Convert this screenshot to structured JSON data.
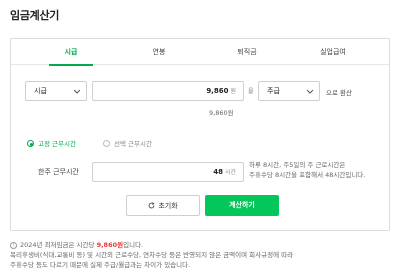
{
  "title": "임금계산기",
  "tabs": [
    {
      "label": "시급",
      "active": true
    },
    {
      "label": "연봉",
      "active": false
    },
    {
      "label": "퇴직금",
      "active": false
    },
    {
      "label": "실업급여",
      "active": false
    }
  ],
  "wage_unit": {
    "selected": "시급"
  },
  "wage_input": {
    "value": "9,860",
    "unit": "원"
  },
  "word_per": "을",
  "convert_unit": {
    "selected": "주급"
  },
  "convert_suffix": "으로 환산",
  "wage_display": "9,860원",
  "work_type": {
    "fixed": "고정 근무시간",
    "flexible": "선택 근무시간",
    "selected": "fixed"
  },
  "weekly_hours": {
    "label": "한주 근무시간",
    "value": "48",
    "unit": "시간"
  },
  "hours_help": [
    "하루 8시간, 주5일의 주 근로시간은",
    "주휴수당 8시간을 포함해서 48시간입니다."
  ],
  "buttons": {
    "reset": "초기화",
    "calculate": "계산하기"
  },
  "notice": {
    "line1_prefix": "2024년 최저임금은 시간당 ",
    "line1_highlight": "9,860원",
    "line1_suffix": "입니다.",
    "line2": "복리후생비(식대,교통비 등) 및 시간외 근로수당, 연차수당 등은 반영되지 않은 금액이며 회사규정에 따라",
    "line3": "주휴수당 등도 다르기 때문에 실제 주급/월급과는 차이가 있습니다."
  },
  "colors": {
    "accent": "#03c75a",
    "accent_text": "#03a94d",
    "highlight": "#e53935"
  },
  "icons": {
    "dropdown": "chevron-down-icon",
    "reset": "refresh-icon",
    "notice": "info-icon"
  }
}
